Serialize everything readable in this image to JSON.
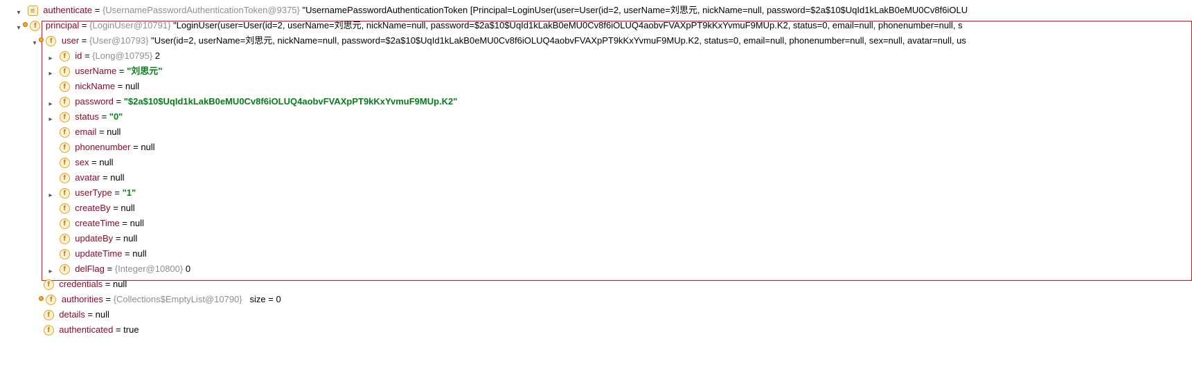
{
  "rows": {
    "authenticate": {
      "name": "authenticate",
      "type": "{UsernamePasswordAuthenticationToken@9375}",
      "value": "\"UsernamePasswordAuthenticationToken [Principal=LoginUser(user=User(id=2, userName=刘思元, nickName=null, password=$2a$10$UqId1kLakB0eMU0Cv8f6iOLU"
    },
    "principal": {
      "name": "principal",
      "type": "{LoginUser@10791}",
      "value": "\"LoginUser(user=User(id=2, userName=刘思元, nickName=null, password=$2a$10$UqId1kLakB0eMU0Cv8f6iOLUQ4aobvFVAXpPT9kKxYvmuF9MUp.K2, status=0, email=null, phonenumber=null, s"
    },
    "user": {
      "name": "user",
      "type": "{User@10793}",
      "value": " \"User(id=2, userName=刘思元, nickName=null, password=$2a$10$UqId1kLakB0eMU0Cv8f6iOLUQ4aobvFVAXpPT9kKxYvmuF9MUp.K2, status=0, email=null, phonenumber=null, sex=null, avatar=null, us"
    },
    "id": {
      "name": "id",
      "type": "{Long@10795}",
      "value": "2"
    },
    "userName": {
      "name": "userName",
      "value": "\"刘思元\""
    },
    "nickName": {
      "name": "nickName",
      "value": "null"
    },
    "password": {
      "name": "password",
      "value": "\"$2a$10$UqId1kLakB0eMU0Cv8f6iOLUQ4aobvFVAXpPT9kKxYvmuF9MUp.K2\""
    },
    "status": {
      "name": "status",
      "value": "\"0\""
    },
    "email": {
      "name": "email",
      "value": "null"
    },
    "phonenumber": {
      "name": "phonenumber",
      "value": "null"
    },
    "sex": {
      "name": "sex",
      "value": "null"
    },
    "avatar": {
      "name": "avatar",
      "value": "null"
    },
    "userType": {
      "name": "userType",
      "value": "\"1\""
    },
    "createBy": {
      "name": "createBy",
      "value": "null"
    },
    "createTime": {
      "name": "createTime",
      "value": "null"
    },
    "updateBy": {
      "name": "updateBy",
      "value": "null"
    },
    "updateTime": {
      "name": "updateTime",
      "value": "null"
    },
    "delFlag": {
      "name": "delFlag",
      "type": "{Integer@10800}",
      "value": "0"
    },
    "credentials": {
      "name": "credentials",
      "value": "null"
    },
    "authorities": {
      "name": "authorities",
      "type": "{Collections$EmptyList@10790}",
      "sizeLabel": "size",
      "sizeValue": "0"
    },
    "details": {
      "name": "details",
      "value": "null"
    },
    "authenticated": {
      "name": "authenticated",
      "value": "true"
    }
  },
  "ops": {
    "eq": " = "
  }
}
